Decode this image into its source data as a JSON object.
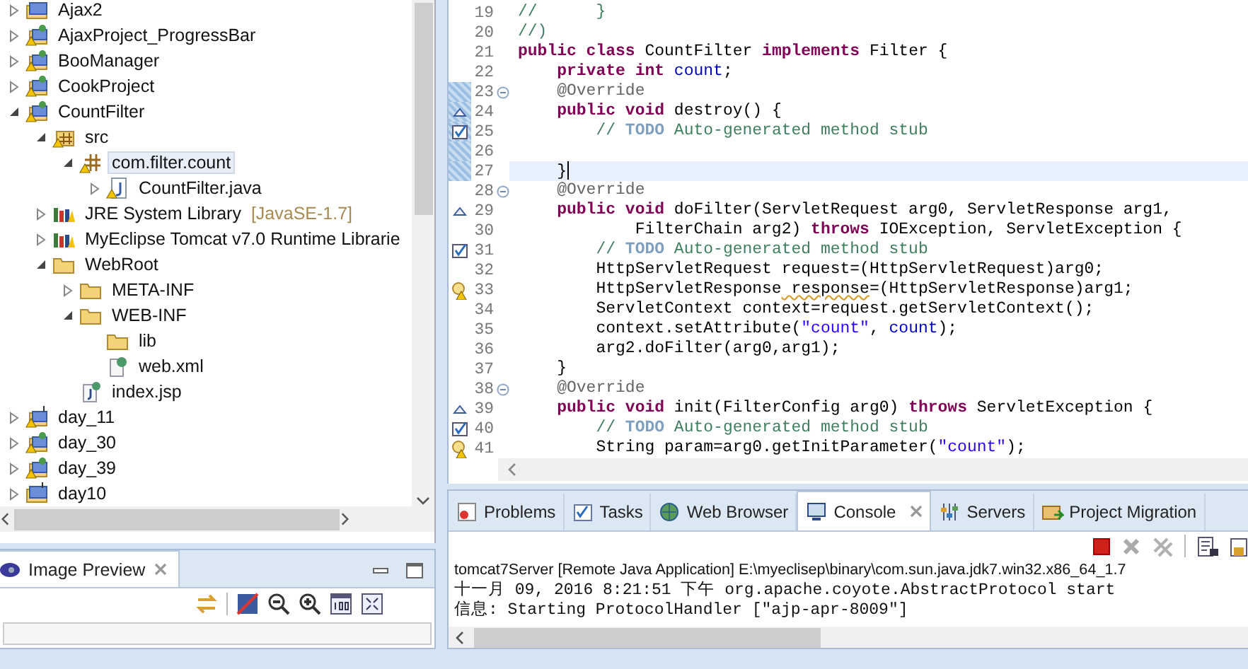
{
  "project_explorer": {
    "items": [
      {
        "label": "Ajax2",
        "kind": "project",
        "expanded": false,
        "selected": false
      },
      {
        "label": "AjaxProject_ProgressBar",
        "kind": "project-warning",
        "expanded": false,
        "selected": false
      },
      {
        "label": "BooManager",
        "kind": "project-warning",
        "expanded": false,
        "selected": false
      },
      {
        "label": "CookProject",
        "kind": "project-warning",
        "expanded": false,
        "selected": false
      },
      {
        "label": "CountFilter",
        "kind": "project-warning",
        "expanded": true,
        "selected": false,
        "children": [
          {
            "label": "src",
            "kind": "source-folder",
            "expanded": true,
            "selected": false,
            "children": [
              {
                "label": "com.filter.count",
                "kind": "package",
                "expanded": true,
                "selected": true,
                "children": [
                  {
                    "label": "CountFilter.java",
                    "kind": "java-file",
                    "expanded": false,
                    "selected": false
                  }
                ]
              }
            ]
          },
          {
            "label": "JRE System Library",
            "decoration": "[JavaSE-1.7]",
            "kind": "library",
            "expanded": false,
            "selected": false
          },
          {
            "label": "MyEclipse Tomcat v7.0 Runtime Librarie",
            "kind": "library",
            "expanded": false,
            "selected": false
          },
          {
            "label": "WebRoot",
            "kind": "folder",
            "expanded": true,
            "selected": false,
            "children": [
              {
                "label": "META-INF",
                "kind": "folder",
                "expanded": false,
                "selected": false
              },
              {
                "label": "WEB-INF",
                "kind": "folder",
                "expanded": true,
                "selected": false,
                "children": [
                  {
                    "label": "lib",
                    "kind": "folder",
                    "selected": false
                  },
                  {
                    "label": "web.xml",
                    "kind": "xml-file",
                    "selected": false
                  }
                ]
              },
              {
                "label": "index.jsp",
                "kind": "jsp-file",
                "selected": false
              }
            ]
          }
        ]
      },
      {
        "label": "day_11",
        "kind": "web-project-warning",
        "expanded": false,
        "selected": false
      },
      {
        "label": "day_30",
        "kind": "project-warning",
        "expanded": false,
        "selected": false
      },
      {
        "label": "day_39",
        "kind": "project-warning",
        "expanded": false,
        "selected": false
      },
      {
        "label": "day10",
        "kind": "web-project",
        "expanded": false,
        "selected": false
      }
    ]
  },
  "image_preview": {
    "tab": {
      "label": "Image Preview",
      "selected": true
    }
  },
  "editor": {
    "lines": [
      {
        "number": "19",
        "segments": [
          {
            "kind": "comment",
            "text": "//      }"
          }
        ]
      },
      {
        "number": "20",
        "segments": [
          {
            "kind": "comment",
            "text": "//)"
          }
        ]
      },
      {
        "number": "21",
        "segments": [
          {
            "kind": "keyword",
            "text": "public class"
          },
          {
            "kind": "plain",
            "text": " CountFilter "
          },
          {
            "kind": "keyword",
            "text": "implements"
          },
          {
            "kind": "plain",
            "text": " Filter {"
          }
        ]
      },
      {
        "number": "22",
        "segments": [
          {
            "kind": "keyword",
            "text": "    private int"
          },
          {
            "kind": "field",
            "text": " count"
          },
          {
            "kind": "plain",
            "text": ";"
          }
        ]
      },
      {
        "number": "23",
        "kind": "fold",
        "changed": true,
        "segments": [
          {
            "kind": "annotation",
            "text": "    @Override"
          }
        ]
      },
      {
        "number": "24",
        "kind": "override",
        "changed": true,
        "segments": [
          {
            "kind": "keyword",
            "text": "    public void"
          },
          {
            "kind": "plain",
            "text": " destroy() {"
          }
        ]
      },
      {
        "number": "25",
        "kind": "task",
        "changed": true,
        "segments": [
          {
            "kind": "comment",
            "text": "        //"
          },
          {
            "kind": "todo",
            "text": " TODO"
          },
          {
            "kind": "comment",
            "text": " Auto-generated method stub"
          }
        ]
      },
      {
        "number": "26",
        "changed": true
      },
      {
        "number": "27",
        "changed": true,
        "current": true,
        "segments": [
          {
            "kind": "plain",
            "text": "    }"
          }
        ]
      },
      {
        "number": "28",
        "kind": "fold",
        "segments": [
          {
            "kind": "annotation",
            "text": "    @Override"
          }
        ]
      },
      {
        "number": "29",
        "kind": "override",
        "segments": [
          {
            "kind": "keyword",
            "text": "    public void"
          },
          {
            "kind": "plain",
            "text": " doFilter(ServletRequest arg0, ServletResponse arg1,"
          }
        ]
      },
      {
        "number": "30",
        "segments": [
          {
            "kind": "plain",
            "text": "            FilterChain arg2)"
          },
          {
            "kind": "keyword",
            "text": " throws"
          },
          {
            "kind": "plain",
            "text": " IOException, ServletException {"
          }
        ]
      },
      {
        "number": "31",
        "kind": "task",
        "segments": [
          {
            "kind": "comment",
            "text": "        //"
          },
          {
            "kind": "todo",
            "text": " TODO"
          },
          {
            "kind": "comment",
            "text": " Auto-generated method stub"
          }
        ]
      },
      {
        "number": "32",
        "segments": [
          {
            "kind": "plain",
            "text": "        HttpServletRequest request=(HttpServletRequest)arg0;"
          }
        ]
      },
      {
        "number": "33",
        "kind": "warning",
        "segments": [
          {
            "kind": "plain",
            "text": "        HttpServletResponse"
          },
          {
            "kind": "squiggle",
            "text": " response"
          },
          {
            "kind": "plain",
            "text": "=(HttpServletResponse)arg1;"
          }
        ]
      },
      {
        "number": "34",
        "segments": [
          {
            "kind": "plain",
            "text": "        ServletContext context=request.getServletContext();"
          }
        ]
      },
      {
        "number": "35",
        "segments": [
          {
            "kind": "plain",
            "text": "        context.setAttribute("
          },
          {
            "kind": "string",
            "text": "\"count\""
          },
          {
            "kind": "plain",
            "text": ", "
          },
          {
            "kind": "field",
            "text": "count"
          },
          {
            "kind": "plain",
            "text": ");"
          }
        ]
      },
      {
        "number": "36",
        "segments": [
          {
            "kind": "plain",
            "text": "        arg2.doFilter(arg0,arg1);"
          }
        ]
      },
      {
        "number": "37",
        "segments": [
          {
            "kind": "plain",
            "text": "    }"
          }
        ]
      },
      {
        "number": "38",
        "kind": "fold",
        "segments": [
          {
            "kind": "annotation",
            "text": "    @Override"
          }
        ]
      },
      {
        "number": "39",
        "kind": "override",
        "segments": [
          {
            "kind": "keyword",
            "text": "    public void"
          },
          {
            "kind": "plain",
            "text": " init(FilterConfig arg0)"
          },
          {
            "kind": "keyword",
            "text": " throws"
          },
          {
            "kind": "plain",
            "text": " ServletException {"
          }
        ]
      },
      {
        "number": "40",
        "kind": "task",
        "segments": [
          {
            "kind": "comment",
            "text": "        //"
          },
          {
            "kind": "todo",
            "text": " TODO"
          },
          {
            "kind": "comment",
            "text": " Auto-generated method stub"
          }
        ]
      },
      {
        "number": "41",
        "kind": "warning",
        "segments": [
          {
            "kind": "plain",
            "text": "        String param=arg0.getInitParameter("
          },
          {
            "kind": "string",
            "text": "\"count\""
          },
          {
            "kind": "plain",
            "text": ");"
          }
        ]
      }
    ]
  },
  "bottom_panel": {
    "tabs": [
      {
        "label": "Problems",
        "kind": "problems",
        "selected": false
      },
      {
        "label": "Tasks",
        "kind": "tasks",
        "selected": false
      },
      {
        "label": "Web Browser",
        "kind": "globe",
        "selected": false
      },
      {
        "label": "Console",
        "kind": "console",
        "selected": true
      },
      {
        "label": "Servers",
        "kind": "servers",
        "selected": false
      },
      {
        "label": "Project Migration",
        "kind": "migration",
        "selected": false
      }
    ],
    "console_title": "tomcat7Server [Remote Java Application] E:\\myeclisep\\binary\\com.sun.java.jdk7.win32.x86_64_1.7",
    "console_lines": [
      "十一月 09, 2016 8:21:51 下午 org.apache.coyote.AbstractProtocol start",
      "信息: Starting ProtocolHandler [\"ajp-apr-8009\"]"
    ]
  }
}
